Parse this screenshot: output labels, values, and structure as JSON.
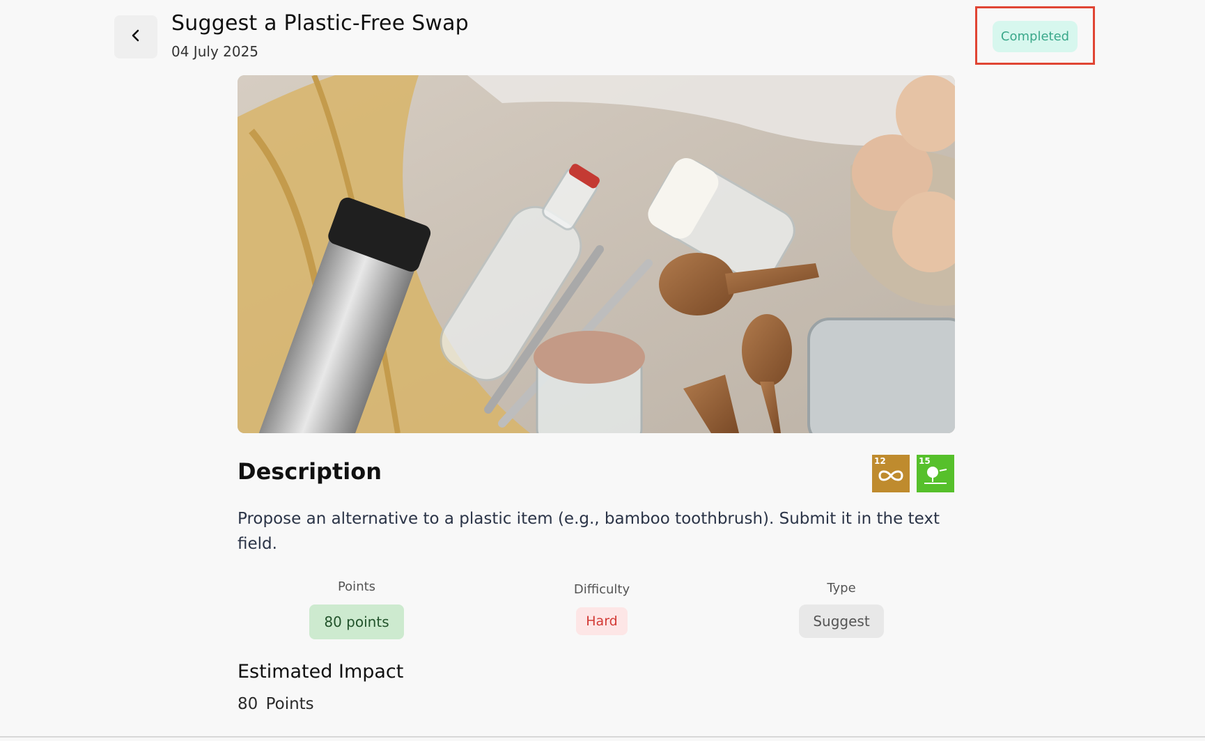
{
  "header": {
    "title": "Suggest a Plastic-Free Swap",
    "date": "04 July 2025",
    "status": "Completed"
  },
  "hero_image": {
    "alt": "plastic-free-items-photo"
  },
  "description": {
    "heading": "Description",
    "text": "Propose an alternative to a plastic item (e.g., bamboo toothbrush). Submit it in the text field.",
    "sdg_badges": [
      {
        "number": "12",
        "color": "#bf8b2e"
      },
      {
        "number": "15",
        "color": "#56c02b"
      }
    ]
  },
  "stats": {
    "points": {
      "label": "Points",
      "value": "80 points"
    },
    "difficulty": {
      "label": "Difficulty",
      "value": "Hard"
    },
    "type": {
      "label": "Type",
      "value": "Suggest"
    }
  },
  "impact": {
    "heading": "Estimated Impact",
    "value": "80  Points"
  },
  "colors": {
    "status_bg": "#d7f7ee",
    "status_text": "#3aa88a",
    "highlight": "#e04534",
    "points_bg": "#cdeacf",
    "hard_text": "#d23a35"
  }
}
